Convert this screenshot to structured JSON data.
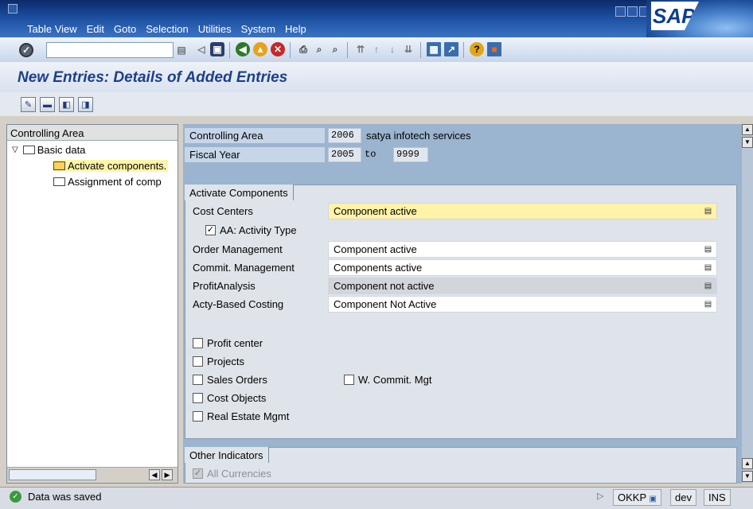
{
  "menu": [
    "Table View",
    "Edit",
    "Goto",
    "Selection",
    "Utilities",
    "System",
    "Help"
  ],
  "brand": "SAP",
  "page_title": "New Entries: Details of Added Entries",
  "nav": {
    "header": "Controlling Area",
    "items": [
      {
        "label": "Basic data"
      },
      {
        "label": "Activate components."
      },
      {
        "label": "Assignment of comp"
      }
    ]
  },
  "header_fields": {
    "controlling_area_label": "Controlling Area",
    "controlling_area_value": "2006",
    "controlling_area_desc": "satya infotech  services",
    "fiscal_year_label": "Fiscal Year",
    "fiscal_year_from": "2005",
    "to_label": "to",
    "fiscal_year_to": "9999"
  },
  "activate_components": {
    "title": "Activate Components",
    "rows": [
      {
        "label": "Cost Centers",
        "value": "Component active"
      },
      {
        "label": "Order Management",
        "value": "Component active"
      },
      {
        "label": "Commit. Management",
        "value": "Components active"
      },
      {
        "label": "ProfitAnalysis",
        "value": "Component not active"
      },
      {
        "label": "Acty-Based Costing",
        "value": "Component Not Active"
      }
    ],
    "aa_activity_type": {
      "label": "AA: Activity Type",
      "checked": true
    },
    "checkboxes": [
      {
        "label": "Profit center",
        "checked": false
      },
      {
        "label": "Projects",
        "checked": false
      },
      {
        "label": "Sales Orders",
        "checked": false
      },
      {
        "label": "Cost Objects",
        "checked": false
      },
      {
        "label": "Real Estate Mgmt",
        "checked": false
      }
    ],
    "w_commit_mgt": {
      "label": "W. Commit. Mgt",
      "checked": false
    }
  },
  "other_indicators": {
    "title": "Other Indicators",
    "all_currencies": {
      "label": "All Currencies",
      "checked": true
    }
  },
  "status": {
    "message": "Data was saved",
    "transaction": "OKKP",
    "system": "dev",
    "mode": "INS"
  }
}
